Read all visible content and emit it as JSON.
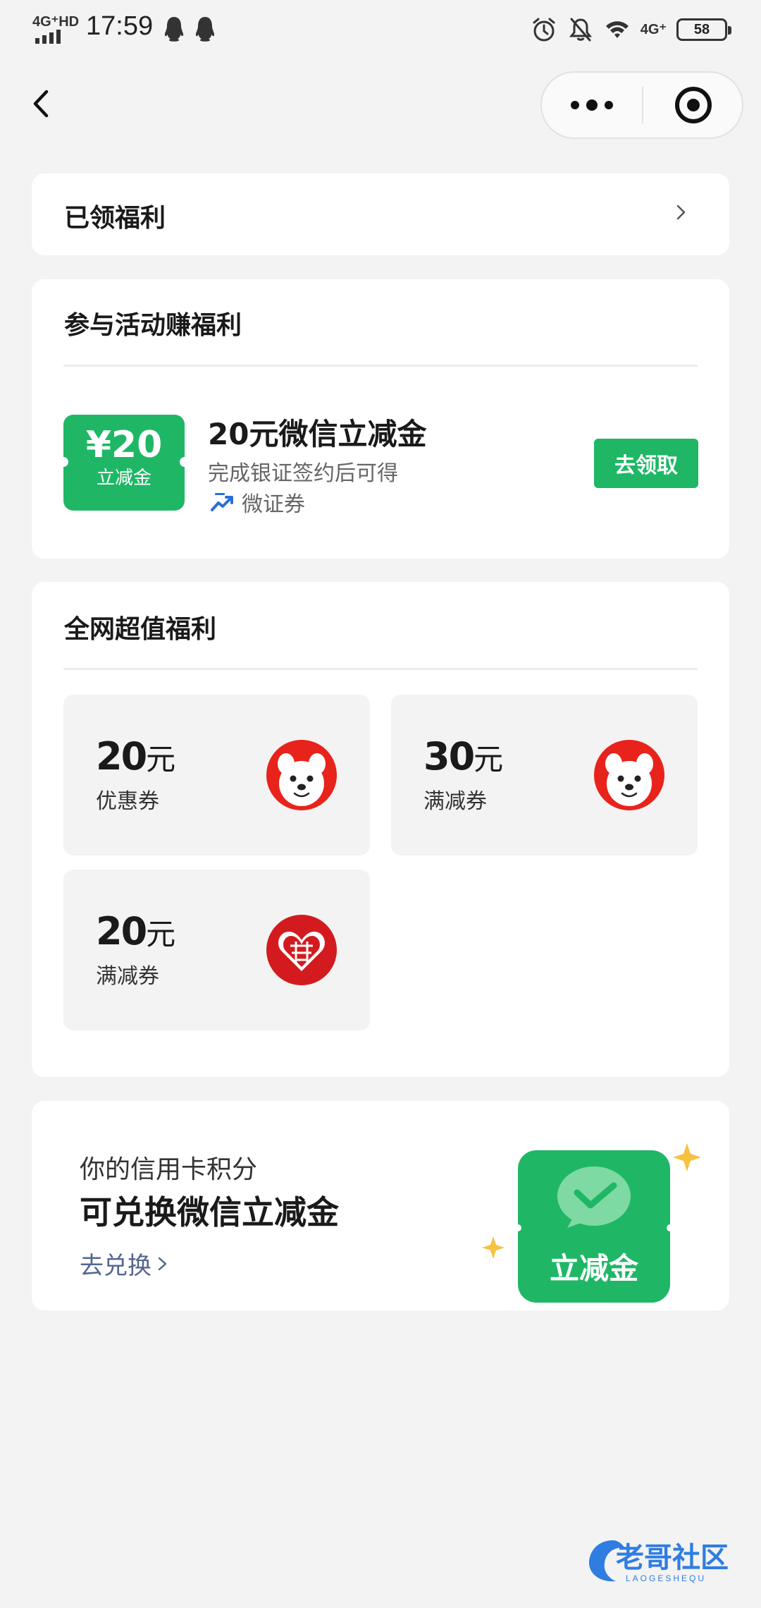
{
  "status_bar": {
    "network": "4G⁺HD",
    "time": "17:59",
    "network_right": "4G⁺",
    "battery": "58",
    "icons": [
      "qq-icon",
      "qq-icon",
      "alarm-icon",
      "mute-icon",
      "wifi-icon"
    ]
  },
  "nav": {
    "back_icon": "chevron-left-icon",
    "more_icon": "more-dots-icon",
    "close_icon": "target-close-icon"
  },
  "received": {
    "title": "已领福利"
  },
  "activity": {
    "title": "参与活动赚福利",
    "ticket_amount": "¥20",
    "ticket_label": "立减金",
    "offer_title": "20元微信立减金",
    "offer_desc": "完成银证签约后可得",
    "offer_source": "微证券",
    "claim_button": "去领取"
  },
  "network_benefits": {
    "title": "全网超值福利",
    "coupons": [
      {
        "amount": "20",
        "unit": "元",
        "label": "优惠券",
        "logo": "jd-joy-dog-icon"
      },
      {
        "amount": "30",
        "unit": "元",
        "label": "满减券",
        "logo": "jd-joy-dog-icon"
      },
      {
        "amount": "20",
        "unit": "元",
        "label": "满减券",
        "logo": "pinduoduo-icon"
      }
    ]
  },
  "points": {
    "subtitle": "你的信用卡积分",
    "title": "可兑换微信立减金",
    "link": "去兑换",
    "art_label": "立减金"
  },
  "watermark": {
    "text": "老哥社区",
    "subtext": "LAOGESHEQU"
  },
  "colors": {
    "accent_green": "#1fb766",
    "link_blue": "#53658f",
    "page_bg": "#f3f3f3",
    "jd_red": "#e8231b",
    "pdd_red": "#d31b1f"
  }
}
